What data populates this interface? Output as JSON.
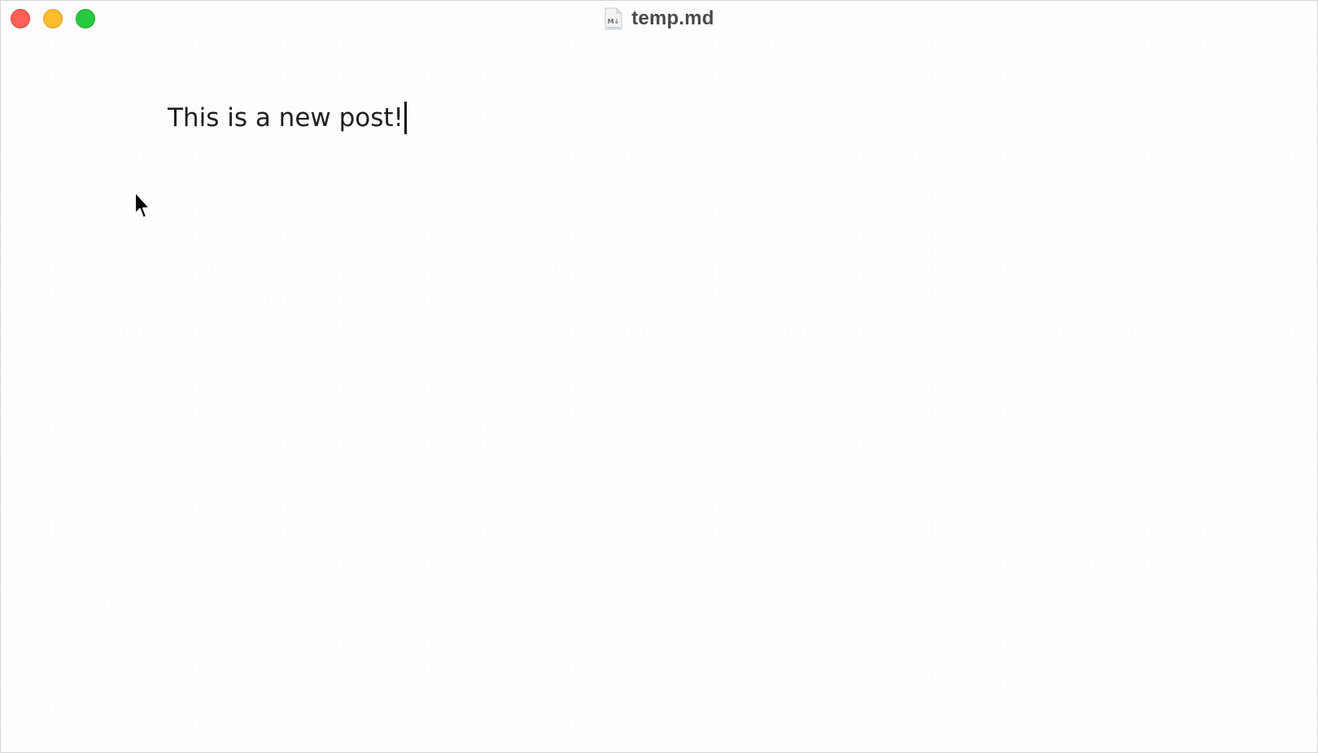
{
  "window": {
    "title": "temp.md",
    "file_icon_label": "M↓"
  },
  "traffic_lights": {
    "close_color": "#ff5f57",
    "minimize_color": "#febc2e",
    "zoom_color": "#28c840"
  },
  "editor": {
    "text": "This is a new post!"
  },
  "icons": {
    "file": "markdown-file-icon",
    "pointer": "mouse-pointer-icon"
  }
}
